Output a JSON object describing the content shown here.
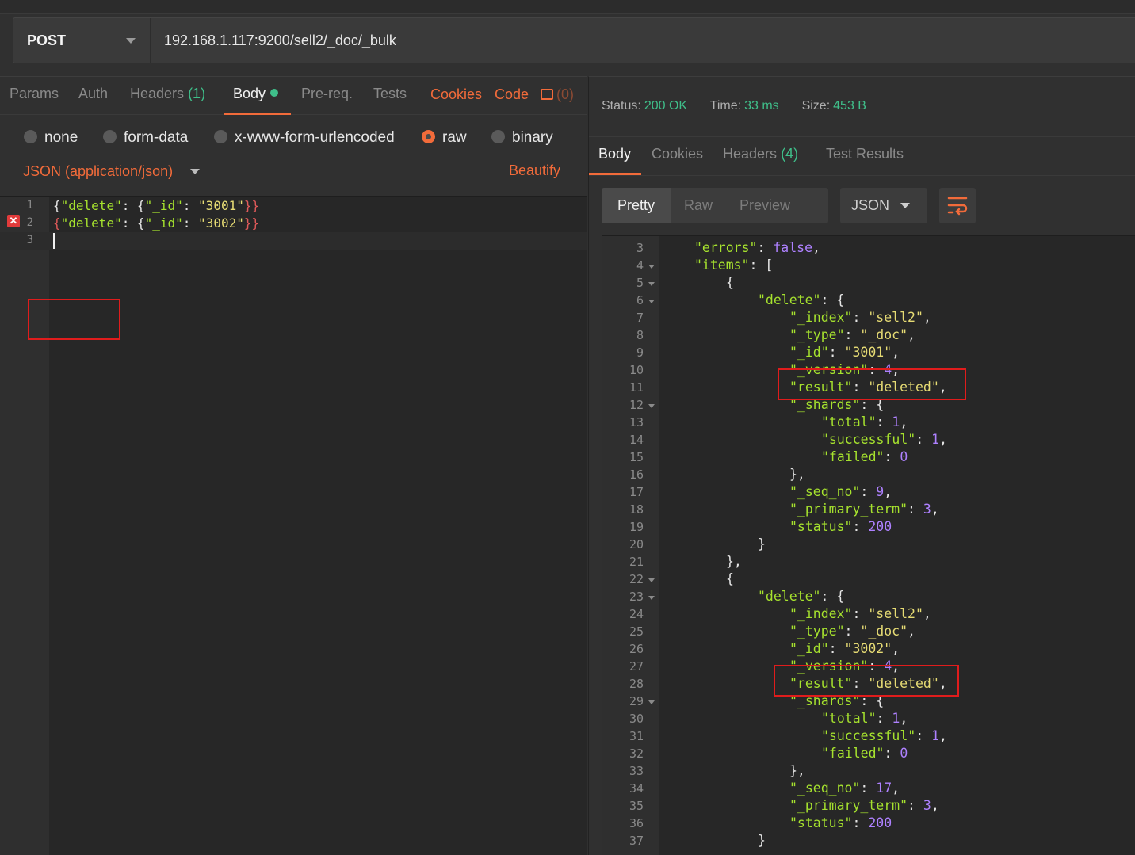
{
  "request": {
    "method": "POST",
    "url": "192.168.1.117:9200/sell2/_doc/_bulk"
  },
  "request_tabs": {
    "params": "Params",
    "auth": "Auth",
    "headers": "Headers",
    "headers_count": "(1)",
    "body": "Body",
    "prereq": "Pre-req.",
    "tests": "Tests",
    "cookies": "Cookies",
    "code": "Code",
    "comments_count": "(0)"
  },
  "body_modes": {
    "none": "none",
    "form_data": "form-data",
    "urlencoded": "x-www-form-urlencoded",
    "raw": "raw",
    "binary": "binary",
    "selected": "raw"
  },
  "content_type": "JSON (application/json)",
  "beautify": "Beautify",
  "request_body": {
    "line_numbers": [
      "1",
      "2",
      "3"
    ],
    "lines": [
      {
        "open": "{",
        "key": "\"delete\"",
        "colon": ": {",
        "key2": "\"_id\"",
        "colon2": ": ",
        "value": "\"3001\"",
        "close": "}}"
      },
      {
        "open": "{",
        "key": "\"delete\"",
        "colon": ": {",
        "key2": "\"_id\"",
        "colon2": ": ",
        "value": "\"3002\"",
        "close": "}}"
      }
    ],
    "error_line": "2"
  },
  "response_status": {
    "status_label": "Status:",
    "status_value": "200 OK",
    "time_label": "Time:",
    "time_value": "33 ms",
    "size_label": "Size:",
    "size_value": "453 B"
  },
  "response_tabs": {
    "body": "Body",
    "cookies": "Cookies",
    "headers": "Headers",
    "headers_count": "(4)",
    "test_results": "Test Results"
  },
  "view_modes": {
    "pretty": "Pretty",
    "raw": "Raw",
    "preview": "Preview",
    "format": "JSON"
  },
  "response_body": {
    "lines": [
      {
        "n": "3",
        "indent": 1,
        "k": "\"errors\"",
        "sep": ": ",
        "v": "false",
        "vt": "n",
        "tail": ","
      },
      {
        "n": "4",
        "indent": 1,
        "k": "\"items\"",
        "sep": ": [",
        "fold": true
      },
      {
        "n": "5",
        "indent": 2,
        "p": "{",
        "fold": true
      },
      {
        "n": "6",
        "indent": 3,
        "k": "\"delete\"",
        "sep": ": {",
        "fold": true
      },
      {
        "n": "7",
        "indent": 4,
        "k": "\"_index\"",
        "sep": ": ",
        "v": "\"sell2\"",
        "vt": "s",
        "tail": ","
      },
      {
        "n": "8",
        "indent": 4,
        "k": "\"_type\"",
        "sep": ": ",
        "v": "\"_doc\"",
        "vt": "s",
        "tail": ","
      },
      {
        "n": "9",
        "indent": 4,
        "k": "\"_id\"",
        "sep": ": ",
        "v": "\"3001\"",
        "vt": "s",
        "tail": ","
      },
      {
        "n": "10",
        "indent": 4,
        "k": "\"_version\"",
        "sep": ": ",
        "v": "4",
        "vt": "n",
        "tail": ","
      },
      {
        "n": "11",
        "indent": 4,
        "k": "\"result\"",
        "sep": ": ",
        "v": "\"deleted\"",
        "vt": "s",
        "tail": ","
      },
      {
        "n": "12",
        "indent": 4,
        "k": "\"_shards\"",
        "sep": ": {",
        "fold": true
      },
      {
        "n": "13",
        "indent": 5,
        "k": "\"total\"",
        "sep": ": ",
        "v": "1",
        "vt": "n",
        "tail": ","
      },
      {
        "n": "14",
        "indent": 5,
        "k": "\"successful\"",
        "sep": ": ",
        "v": "1",
        "vt": "n",
        "tail": ","
      },
      {
        "n": "15",
        "indent": 5,
        "k": "\"failed\"",
        "sep": ": ",
        "v": "0",
        "vt": "n"
      },
      {
        "n": "16",
        "indent": 4,
        "p": "},"
      },
      {
        "n": "17",
        "indent": 4,
        "k": "\"_seq_no\"",
        "sep": ": ",
        "v": "9",
        "vt": "n",
        "tail": ","
      },
      {
        "n": "18",
        "indent": 4,
        "k": "\"_primary_term\"",
        "sep": ": ",
        "v": "3",
        "vt": "n",
        "tail": ","
      },
      {
        "n": "19",
        "indent": 4,
        "k": "\"status\"",
        "sep": ": ",
        "v": "200",
        "vt": "n"
      },
      {
        "n": "20",
        "indent": 3,
        "p": "}"
      },
      {
        "n": "21",
        "indent": 2,
        "p": "},"
      },
      {
        "n": "22",
        "indent": 2,
        "p": "{",
        "fold": true
      },
      {
        "n": "23",
        "indent": 3,
        "k": "\"delete\"",
        "sep": ": {",
        "fold": true
      },
      {
        "n": "24",
        "indent": 4,
        "k": "\"_index\"",
        "sep": ": ",
        "v": "\"sell2\"",
        "vt": "s",
        "tail": ","
      },
      {
        "n": "25",
        "indent": 4,
        "k": "\"_type\"",
        "sep": ": ",
        "v": "\"_doc\"",
        "vt": "s",
        "tail": ","
      },
      {
        "n": "26",
        "indent": 4,
        "k": "\"_id\"",
        "sep": ": ",
        "v": "\"3002\"",
        "vt": "s",
        "tail": ","
      },
      {
        "n": "27",
        "indent": 4,
        "k": "\"_version\"",
        "sep": ": ",
        "v": "4",
        "vt": "n",
        "tail": ","
      },
      {
        "n": "28",
        "indent": 4,
        "k": "\"result\"",
        "sep": ": ",
        "v": "\"deleted\"",
        "vt": "s",
        "tail": ","
      },
      {
        "n": "29",
        "indent": 4,
        "k": "\"_shards\"",
        "sep": ": {",
        "fold": true
      },
      {
        "n": "30",
        "indent": 5,
        "k": "\"total\"",
        "sep": ": ",
        "v": "1",
        "vt": "n",
        "tail": ","
      },
      {
        "n": "31",
        "indent": 5,
        "k": "\"successful\"",
        "sep": ": ",
        "v": "1",
        "vt": "n",
        "tail": ","
      },
      {
        "n": "32",
        "indent": 5,
        "k": "\"failed\"",
        "sep": ": ",
        "v": "0",
        "vt": "n"
      },
      {
        "n": "33",
        "indent": 4,
        "p": "},"
      },
      {
        "n": "34",
        "indent": 4,
        "k": "\"_seq_no\"",
        "sep": ": ",
        "v": "17",
        "vt": "n",
        "tail": ","
      },
      {
        "n": "35",
        "indent": 4,
        "k": "\"_primary_term\"",
        "sep": ": ",
        "v": "3",
        "vt": "n",
        "tail": ","
      },
      {
        "n": "36",
        "indent": 4,
        "k": "\"status\"",
        "sep": ": ",
        "v": "200",
        "vt": "n"
      },
      {
        "n": "37",
        "indent": 3,
        "p": "}"
      }
    ]
  },
  "colors": {
    "accent": "#f26b3a",
    "success": "#3fbf8a",
    "json_key": "#a6e22e",
    "json_string": "#e6db74",
    "json_number": "#ae81ff",
    "highlight_box": "#e01c1c"
  },
  "icons": {
    "method_dropdown": "chevron-down-icon",
    "comments": "comment-icon",
    "error": "error-x-icon",
    "wrap": "wrap-lines-icon"
  }
}
